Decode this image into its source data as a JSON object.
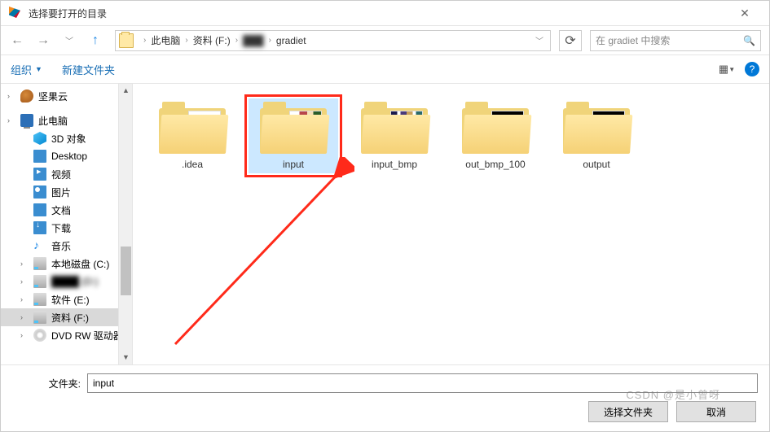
{
  "titlebar": {
    "title": "选择要打开的目录"
  },
  "nav": {
    "breadcrumb": [
      "此电脑",
      "资料 (F:)",
      "███",
      "gradiet"
    ],
    "search_placeholder": "在 gradiet 中搜索"
  },
  "toolbar": {
    "organize": "组织",
    "new_folder": "新建文件夹"
  },
  "sidebar": {
    "items": [
      {
        "label": "坚果云",
        "icon": "nut",
        "sub": false
      },
      {
        "label": "此电脑",
        "icon": "pc",
        "sub": false
      },
      {
        "label": "3D 对象",
        "icon": "cube",
        "sub": true
      },
      {
        "label": "Desktop",
        "icon": "desktop",
        "sub": true
      },
      {
        "label": "视频",
        "icon": "video",
        "sub": true
      },
      {
        "label": "图片",
        "icon": "pic",
        "sub": true
      },
      {
        "label": "文档",
        "icon": "doc",
        "sub": true
      },
      {
        "label": "下载",
        "icon": "down",
        "sub": true
      },
      {
        "label": "音乐",
        "icon": "music",
        "sub": true
      },
      {
        "label": "本地磁盘 (C:)",
        "icon": "disk",
        "sub": true
      },
      {
        "label": "████ (D:)",
        "icon": "disk",
        "sub": true,
        "blur": true
      },
      {
        "label": "软件 (E:)",
        "icon": "disk",
        "sub": true
      },
      {
        "label": "资料 (F:)",
        "icon": "disk",
        "sub": true,
        "selected": true
      },
      {
        "label": "DVD RW 驱动器",
        "icon": "dvd",
        "sub": true
      }
    ]
  },
  "content": {
    "folders": [
      {
        "name": ".idea",
        "thumb": "paper"
      },
      {
        "name": "input",
        "thumb": "fruit",
        "selected": true
      },
      {
        "name": "input_bmp",
        "thumb": "stripes"
      },
      {
        "name": "out_bmp_100",
        "thumb": "code"
      },
      {
        "name": "output",
        "thumb": "outline"
      }
    ]
  },
  "bottom": {
    "folder_label": "文件夹:",
    "folder_value": "input",
    "select_btn": "选择文件夹",
    "cancel_btn": "取消"
  },
  "watermark": "CSDN @是小曾呀"
}
